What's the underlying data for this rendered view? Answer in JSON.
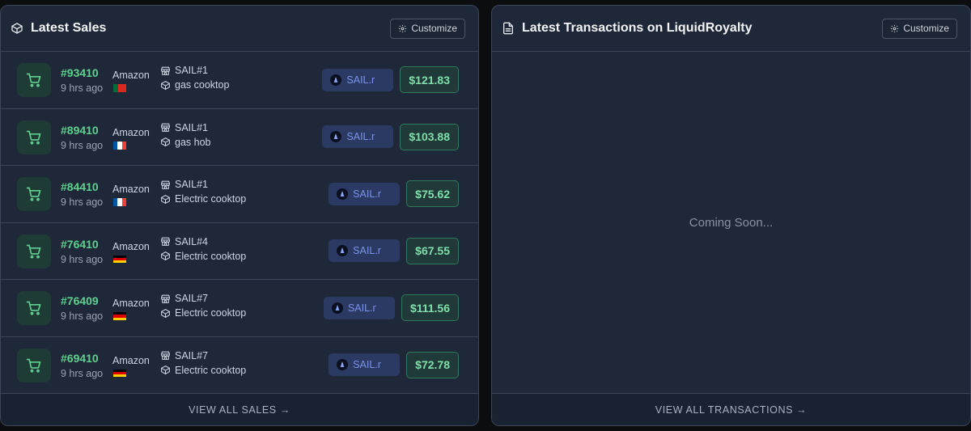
{
  "sales_panel": {
    "title": "Latest Sales",
    "customize_label": "Customize",
    "footer_link": "VIEW ALL SALES →",
    "rows": [
      {
        "order_id": "#93410",
        "time": "9 hrs ago",
        "store": "Amazon",
        "flag": "portugal",
        "sail": "SAIL#1",
        "product": "gas cooktop",
        "token": "SAIL.r",
        "price": "$121.83"
      },
      {
        "order_id": "#89410",
        "time": "9 hrs ago",
        "store": "Amazon",
        "flag": "france",
        "sail": "SAIL#1",
        "product": "gas hob",
        "token": "SAIL.r",
        "price": "$103.88"
      },
      {
        "order_id": "#84410",
        "time": "9 hrs ago",
        "store": "Amazon",
        "flag": "france",
        "sail": "SAIL#1",
        "product": "Electric cooktop",
        "token": "SAIL.r",
        "price": "$75.62"
      },
      {
        "order_id": "#76410",
        "time": "9 hrs ago",
        "store": "Amazon",
        "flag": "germany",
        "sail": "SAIL#4",
        "product": "Electric cooktop",
        "token": "SAIL.r",
        "price": "$67.55"
      },
      {
        "order_id": "#76409",
        "time": "9 hrs ago",
        "store": "Amazon",
        "flag": "germany",
        "sail": "SAIL#7",
        "product": "Electric cooktop",
        "token": "SAIL.r",
        "price": "$111.56"
      },
      {
        "order_id": "#69410",
        "time": "9 hrs ago",
        "store": "Amazon",
        "flag": "germany",
        "sail": "SAIL#7",
        "product": "Electric cooktop",
        "token": "SAIL.r",
        "price": "$72.78"
      }
    ]
  },
  "transactions_panel": {
    "title": "Latest Transactions on LiquidRoyalty",
    "customize_label": "Customize",
    "placeholder": "Coming Soon...",
    "footer_link": "VIEW ALL TRANSACTIONS →"
  },
  "icons": {
    "sales_header": "cube-icon",
    "tx_header": "document-icon",
    "customize": "gear-icon",
    "row": "shopping-cart-icon",
    "sail": "store-icon",
    "product": "package-icon",
    "token": "sail-token-icon"
  },
  "colors": {
    "accent_green": "#5fd08f",
    "price_text": "#7ee0a8",
    "token_text": "#7b93ee",
    "panel_bg": "#1e2838"
  }
}
